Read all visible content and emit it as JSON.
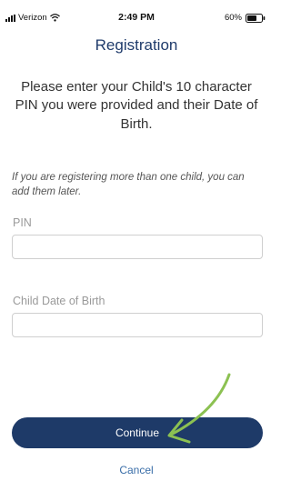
{
  "status_bar": {
    "carrier": "Verizon",
    "time": "2:49 PM",
    "battery": "60%"
  },
  "header": {
    "title": "Registration"
  },
  "main": {
    "intro": "Please enter your Child's 10 character PIN you were provided and their Date of Birth.",
    "note": "If you are registering more than one child, you can add them later.",
    "pin_label": "PIN",
    "pin_value": "",
    "dob_label": "Child Date of Birth",
    "dob_value": ""
  },
  "actions": {
    "continue_label": "Continue",
    "cancel_label": "Cancel"
  },
  "colors": {
    "primary": "#1e3a68",
    "link": "#3a6ea8",
    "annotation": "#8cc152"
  }
}
